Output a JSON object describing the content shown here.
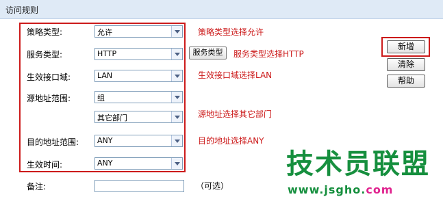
{
  "header": {
    "title": "访问规则"
  },
  "form": {
    "policy_type": {
      "label": "策略类型:",
      "value": "允许",
      "note": "策略类型选择允许"
    },
    "service_type": {
      "label": "服务类型:",
      "value": "HTTP",
      "button": "服务类型",
      "note": "服务类型选择HTTP"
    },
    "interface": {
      "label": "生效接口域:",
      "value": "LAN",
      "note": "生效接口域选择LAN"
    },
    "source_range": {
      "label": "源地址范围:",
      "value": "组",
      "sub_value": "其它部门",
      "note": "源地址选择其它部门"
    },
    "dest_range": {
      "label": "目的地址范围:",
      "value": "ANY",
      "note": "目的地址选择ANY"
    },
    "effective_time": {
      "label": "生效时间:",
      "value": "ANY"
    },
    "remark": {
      "label": "备注:",
      "value": "",
      "optional": "（可选）"
    }
  },
  "actions": {
    "add": "新增",
    "clear": "清除",
    "help": "帮助"
  },
  "watermark": {
    "title": "技术员联盟",
    "url": "www.jsgho.",
    "url_suffix": "com"
  },
  "colors": {
    "annotation": "#cc1a1a",
    "header_bg": "#dfeaf6",
    "watermark": "#168f3e",
    "watermark_suffix": "#e0228e"
  }
}
